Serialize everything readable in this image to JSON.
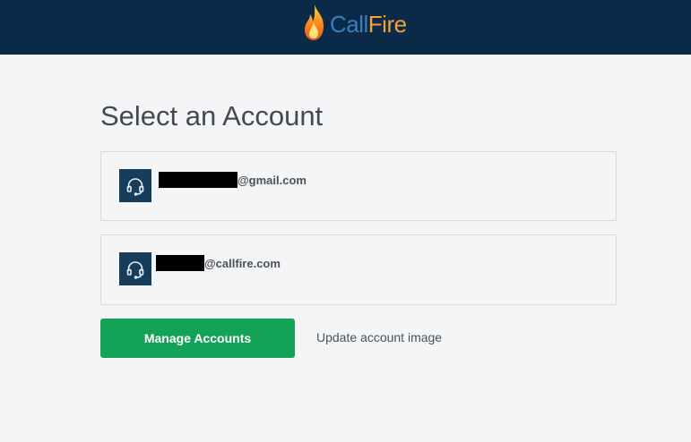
{
  "header": {
    "brand_primary": "Call",
    "brand_secondary": "Fire",
    "background_color": "#0b2a47",
    "brand_colors": {
      "call": "#3b7bbf",
      "fire": "#f2a23a"
    },
    "logo_icon": "flame-icon"
  },
  "page": {
    "title": "Select an Account"
  },
  "accounts": [
    {
      "email_suffix": "@gmail.com",
      "avatar_icon": "headset-icon",
      "redacted": true
    },
    {
      "email_suffix": "@callfire.com",
      "avatar_icon": "headset-icon",
      "redacted": true
    }
  ],
  "actions": {
    "manage_label": "Manage Accounts",
    "manage_color": "#14a356",
    "update_label": "Update account image"
  }
}
